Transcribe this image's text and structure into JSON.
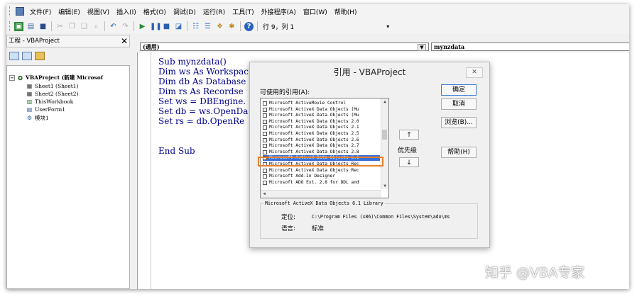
{
  "menubar": {
    "items": [
      "文件(F)",
      "编辑(E)",
      "视图(V)",
      "插入(I)",
      "格式(O)",
      "调试(D)",
      "运行(R)",
      "工具(T)",
      "外接程序(A)",
      "窗口(W)",
      "帮助(H)"
    ]
  },
  "toolbar": {
    "position": "行 9，列 1"
  },
  "project": {
    "title": "工程 - VBAProject",
    "close": "✕",
    "tree": {
      "root": "VBAProject (新建 Microsof",
      "items": [
        "Sheet1 (Sheet1)",
        "Sheet2 (Sheet2)",
        "ThisWorkbook",
        "UserForm1",
        "模块1"
      ]
    }
  },
  "code": {
    "object_combo": "(通用)",
    "proc_combo": "mynzdata",
    "lines": [
      "Sub mynzdata()",
      "Dim ws As Workspac",
      "Dim db As Database",
      "Dim rs As Recordse",
      "Set ws = DBEngine.",
      "Set db = ws.OpenDa",
      "Set rs = db.OpenRe",
      "End Sub"
    ]
  },
  "dialog": {
    "title": "引用 - VBAProject",
    "close": "✕",
    "available_label": "可使用的引用(A):",
    "references": [
      {
        "name": "Microsoft ActiveMovie Control",
        "checked": false
      },
      {
        "name": "Microsoft ActiveX Data Objects (Mu",
        "checked": false
      },
      {
        "name": "Microsoft ActiveX Data Objects (Mu",
        "checked": false
      },
      {
        "name": "Microsoft ActiveX Data Objects 2.0",
        "checked": false
      },
      {
        "name": "Microsoft ActiveX Data Objects 2.1",
        "checked": false
      },
      {
        "name": "Microsoft ActiveX Data Objects 2.5",
        "checked": false
      },
      {
        "name": "Microsoft ActiveX Data Objects 2.6",
        "checked": false
      },
      {
        "name": "Microsoft ActiveX Data Objects 2.7",
        "checked": false
      },
      {
        "name": "Microsoft ActiveX Data Objects 2.8",
        "checked": false
      },
      {
        "name": "Microsoft ActiveX Data Objects 6.1",
        "checked": true,
        "selected": true
      },
      {
        "name": "Microsoft ActiveX Data Objects Rec",
        "checked": false
      },
      {
        "name": "Microsoft ActiveX Data Objects Rec",
        "checked": false
      },
      {
        "name": "Microsoft Add-In Designer",
        "checked": false
      },
      {
        "name": "Microsoft ADO Ext. 2.8 for DDL and",
        "checked": false
      }
    ],
    "priority_label": "优先级",
    "priority_up": "↑",
    "priority_down": "↓",
    "buttons": {
      "ok": "确定",
      "cancel": "取消",
      "browse": "浏览(B)...",
      "help": "帮助(H)"
    },
    "group_title": "Microsoft ActiveX Data Objects 6.1 Library",
    "location_label": "定位:",
    "location_value": "C:\\Program Files (x86)\\Common Files\\System\\ado\\ms",
    "language_label": "语言:",
    "language_value": "标准"
  },
  "watermark": "知乎 @VBA专家",
  "colors": {
    "selection": "#3a6fd8",
    "highlight": "#e8802a",
    "code_text": "#00008b"
  }
}
